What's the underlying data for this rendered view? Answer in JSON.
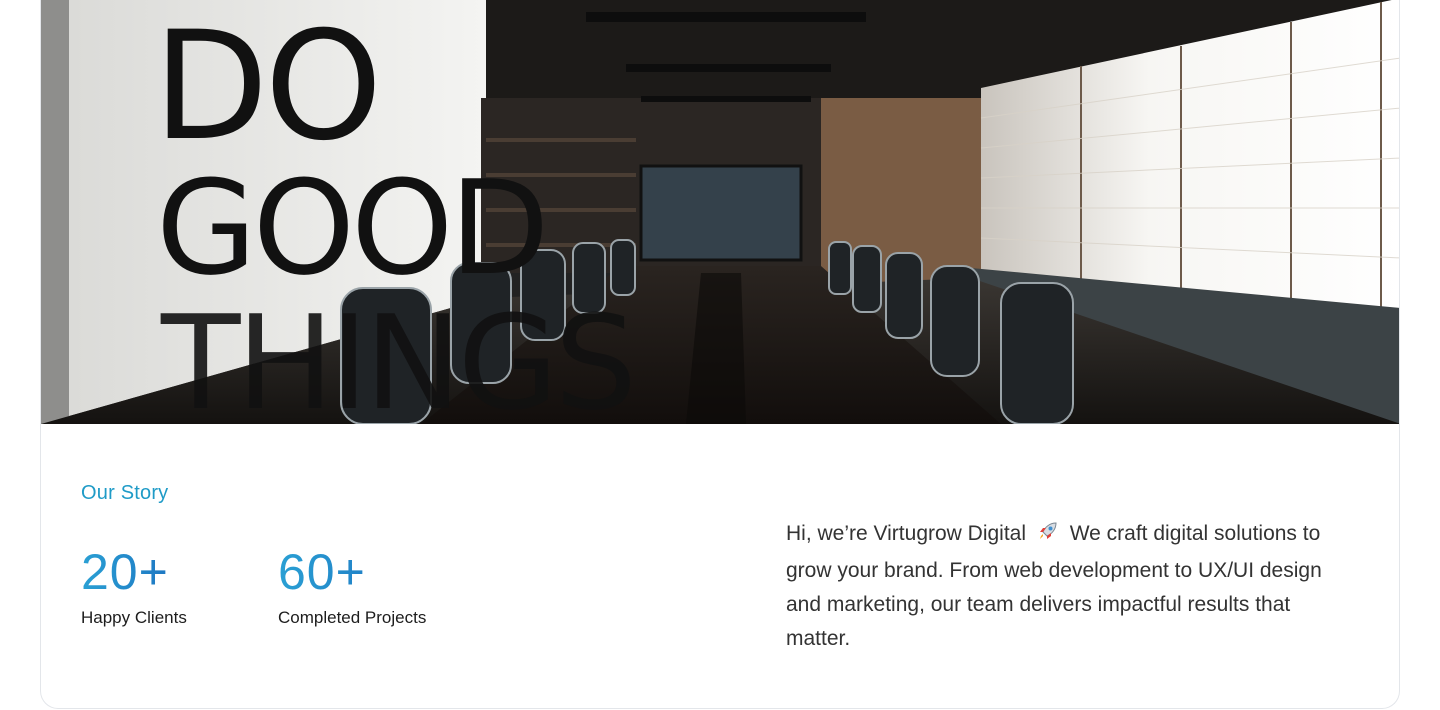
{
  "hero": {
    "wall_text_lines": [
      "DO",
      "GOOD",
      "THINGS"
    ]
  },
  "story": {
    "section_label": "Our Story",
    "stats": [
      {
        "value": "20+",
        "label": "Happy Clients"
      },
      {
        "value": "60+",
        "label": "Completed Projects"
      }
    ],
    "intro_before_icon": "Hi, we’re Virtugrow Digital",
    "intro_after_icon": "We craft digital solutions to grow your brand. From web development to UX/UI design and marketing, our team delivers impactful results that matter.",
    "icon": "rocket-icon"
  },
  "colors": {
    "accent": "#1f9bc7",
    "gradient_start": "#2aa0d4",
    "gradient_end": "#1b6fbf",
    "body_text": "#333333"
  }
}
